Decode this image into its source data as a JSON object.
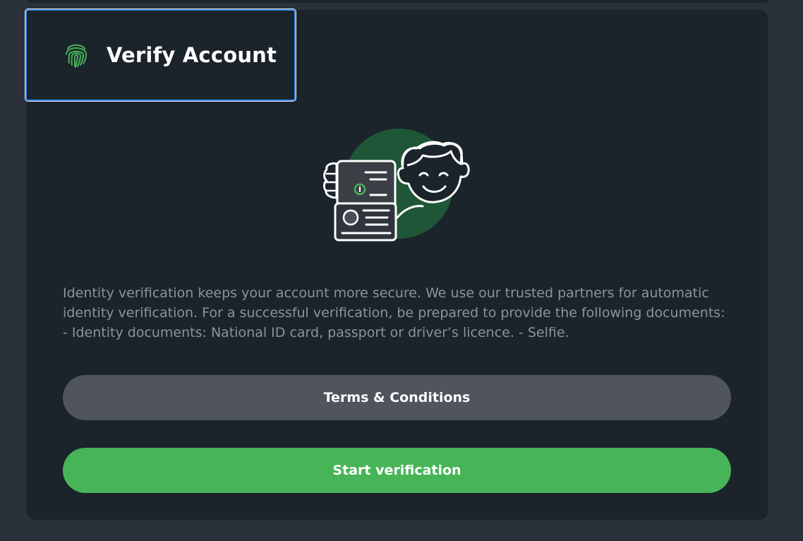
{
  "header": {
    "title": "Verify Account",
    "icon": "fingerprint-icon"
  },
  "illustration": {
    "icon": "identity-verification-illustration"
  },
  "description": "Identity verification keeps your account more secure. We use our trusted partners for automatic identity verification. For a successful verification, be prepared to provide the following documents: - Identity documents: National ID card, passport or driver’s licence. - Selfie.",
  "buttons": {
    "terms_label": "Terms & Conditions",
    "start_label": "Start verification"
  },
  "colors": {
    "background": "#2b313a",
    "card": "#1b232b",
    "accent_green": "#47b457",
    "secondary_button": "#4f545d",
    "focus_border": "#3d8ef0",
    "body_text": "#8b939c"
  }
}
